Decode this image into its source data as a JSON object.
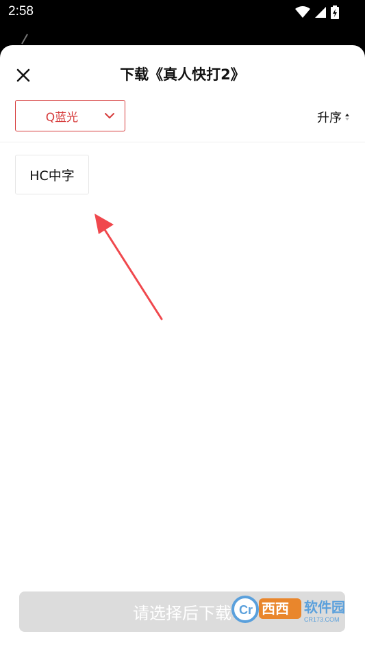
{
  "status_bar": {
    "time": "2:58",
    "icons": [
      "wifi-icon",
      "cellular-signal-icon",
      "battery-charging-icon"
    ]
  },
  "sheet": {
    "title": "下载《真人快打2》",
    "close_icon": "close-icon",
    "quality_select": {
      "selected": "Q蓝光",
      "icon": "chevron-down-icon"
    },
    "sort": {
      "label": "升序",
      "icon": "sort-arrows-icon"
    },
    "options": [
      "HC中字"
    ],
    "confirm_button": "请选择后下载"
  },
  "watermark": {
    "logo_text": "Cr",
    "site_name": "西西软件园",
    "domain": "CR173.COM"
  },
  "colors": {
    "accent": "#d63b3b",
    "annotation_arrow": "#f0484d",
    "disabled_button": "#dcdcdc"
  }
}
